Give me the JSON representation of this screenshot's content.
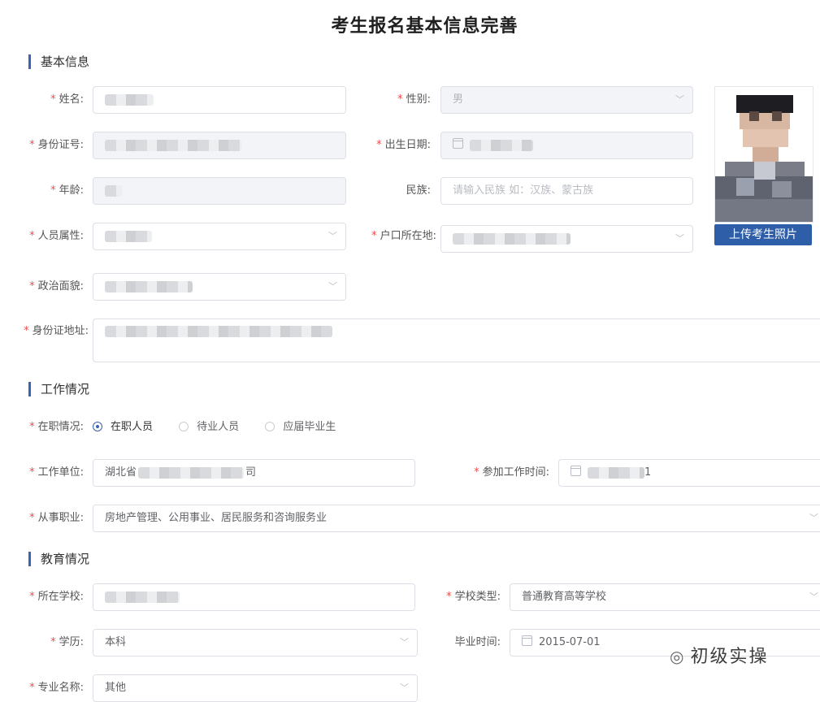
{
  "page_title": "考生报名基本信息完善",
  "sections": {
    "basic": "基本信息",
    "work": "工作情况",
    "education": "教育情况"
  },
  "basic": {
    "name_label": "姓名:",
    "gender_label": "性别:",
    "gender_value": "男",
    "id_label": "身份证号:",
    "birth_label": "出生日期:",
    "age_label": "年龄:",
    "ethnicity_label": "民族:",
    "ethnicity_placeholder": "请输入民族 如：汉族、蒙古族",
    "person_type_label": "人员属性:",
    "hukou_label": "户口所在地:",
    "political_label": "政治面貌:",
    "id_address_label": "身份证地址:",
    "upload_photo": "上传考生照片"
  },
  "work": {
    "status_label": "在职情况:",
    "options": [
      "在职人员",
      "待业人员",
      "应届毕业生"
    ],
    "selected": "在职人员",
    "employer_label": "工作单位:",
    "employer_prefix": "湖北省",
    "employer_suffix": "司",
    "start_label": "参加工作时间:",
    "start_end_char": "1",
    "industry_label": "从事职业:",
    "industry_value": "房地产管理、公用事业、居民服务和咨询服务业"
  },
  "education": {
    "school_label": "所在学校:",
    "school_type_label": "学校类型:",
    "school_type_value": "普通教育高等学校",
    "degree_label": "学历:",
    "degree_value": "本科",
    "grad_label": "毕业时间:",
    "grad_value": "2015-07-01",
    "major_label": "专业名称:",
    "major_value": "其他"
  },
  "watermark": "初级实操",
  "colors": {
    "accent": "#3b63b0",
    "required": "#f04b4b",
    "upload_button": "#2f5ea8"
  }
}
